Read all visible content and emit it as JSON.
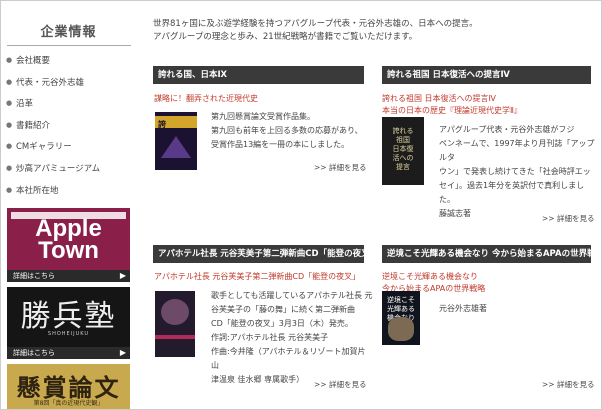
{
  "sidebar": {
    "title": "企業情報",
    "items": [
      {
        "label": "会社概要"
      },
      {
        "label": "代表・元谷外志雄"
      },
      {
        "label": "沿革"
      },
      {
        "label": "書籍紹介"
      },
      {
        "label": "CMギャラリー"
      },
      {
        "label": "炒高アパミュージアム"
      },
      {
        "label": "本社所在地"
      }
    ],
    "banners": [
      {
        "name": "Apple Town",
        "line1": "Apple",
        "line2": "Town",
        "link": "詳細はこちら",
        "icon": "arrow-right-icon"
      },
      {
        "name": "勝兵塾",
        "title": "勝兵塾",
        "roman": "SHOHEIJUKU",
        "link": "詳細はこちら",
        "icon": "arrow-right-icon"
      },
      {
        "name": "懸賞論文",
        "title": "懸賞論文",
        "subtitle": "第8回「真の近現代史観」"
      }
    ]
  },
  "intro": {
    "line1": "世界81ヶ国に及ぶ遊学経験を持つアパグループ代表・元谷外志雄の、日本への提言。",
    "line2": "アパグループの理念と歩み、21世紀戦略が書籍でご覧いただけます。"
  },
  "cards": [
    {
      "header": "誇れる国、日本Ⅸ",
      "red_lines": [
        "謀略に！翻弄された近現代史"
      ],
      "body_lines": [
        "第九回懸賞論文受賞作品集。",
        "第九回も前年を上回る多数の応募があり、",
        "受賞作品13編を一冊の本にしました。"
      ],
      "more": ">> 詳細を見る",
      "cover_text": "誇"
    },
    {
      "header": "誇れる祖国 日本復活への提言Ⅳ",
      "red_lines": [
        "誇れる祖国 日本復活への提言Ⅳ",
        "本当の日本の歴史『理論近現代史学Ⅱ』"
      ],
      "body_lines": [
        "アパグループ代表・元谷外志雄がフジ",
        "ペンネームで、1997年より月刊誌「アップルタ",
        "ウン」で発表し続けてきた「社会時評エッ",
        "セイ」。過去1年分を英訳付で真利しました。",
        "藤誠志著"
      ],
      "more": ">> 詳細を見る",
      "cover_text": "誇れる祖国 日本復活への提言"
    },
    {
      "header": "アパホテル社長 元谷芙美子第二弾新曲CD「能登の夜叉」",
      "red_lines": [
        "アパホテル社長 元谷芙美子第二弾新曲CD「能登の夜叉」"
      ],
      "body_lines": [
        "歌手としても活躍しているアパホテル社長 元",
        "谷芙美子の「藤の舞」に続く第二弾新曲",
        "CD「能登の夜叉」3月3日（木）発売。",
        "作詞:アパホテル社長 元谷芙美子",
        "作曲:今井隆（アパホテル＆リゾート加賀片山",
        "津温泉 佳水郷 専属歌手）"
      ],
      "more": ">> 詳細を見る"
    },
    {
      "header": "逆境こそ光輝ある機会なり 今から始まるAPAの世界戦略",
      "red_lines": [
        "逆境こそ光輝ある機会なり",
        "今から始まるAPAの世界戦略"
      ],
      "body_lines": [
        "元谷外志雄著"
      ],
      "more": ">> 詳細を見る",
      "cover_text": "逆境こそ光輝ある機会なり"
    }
  ]
}
